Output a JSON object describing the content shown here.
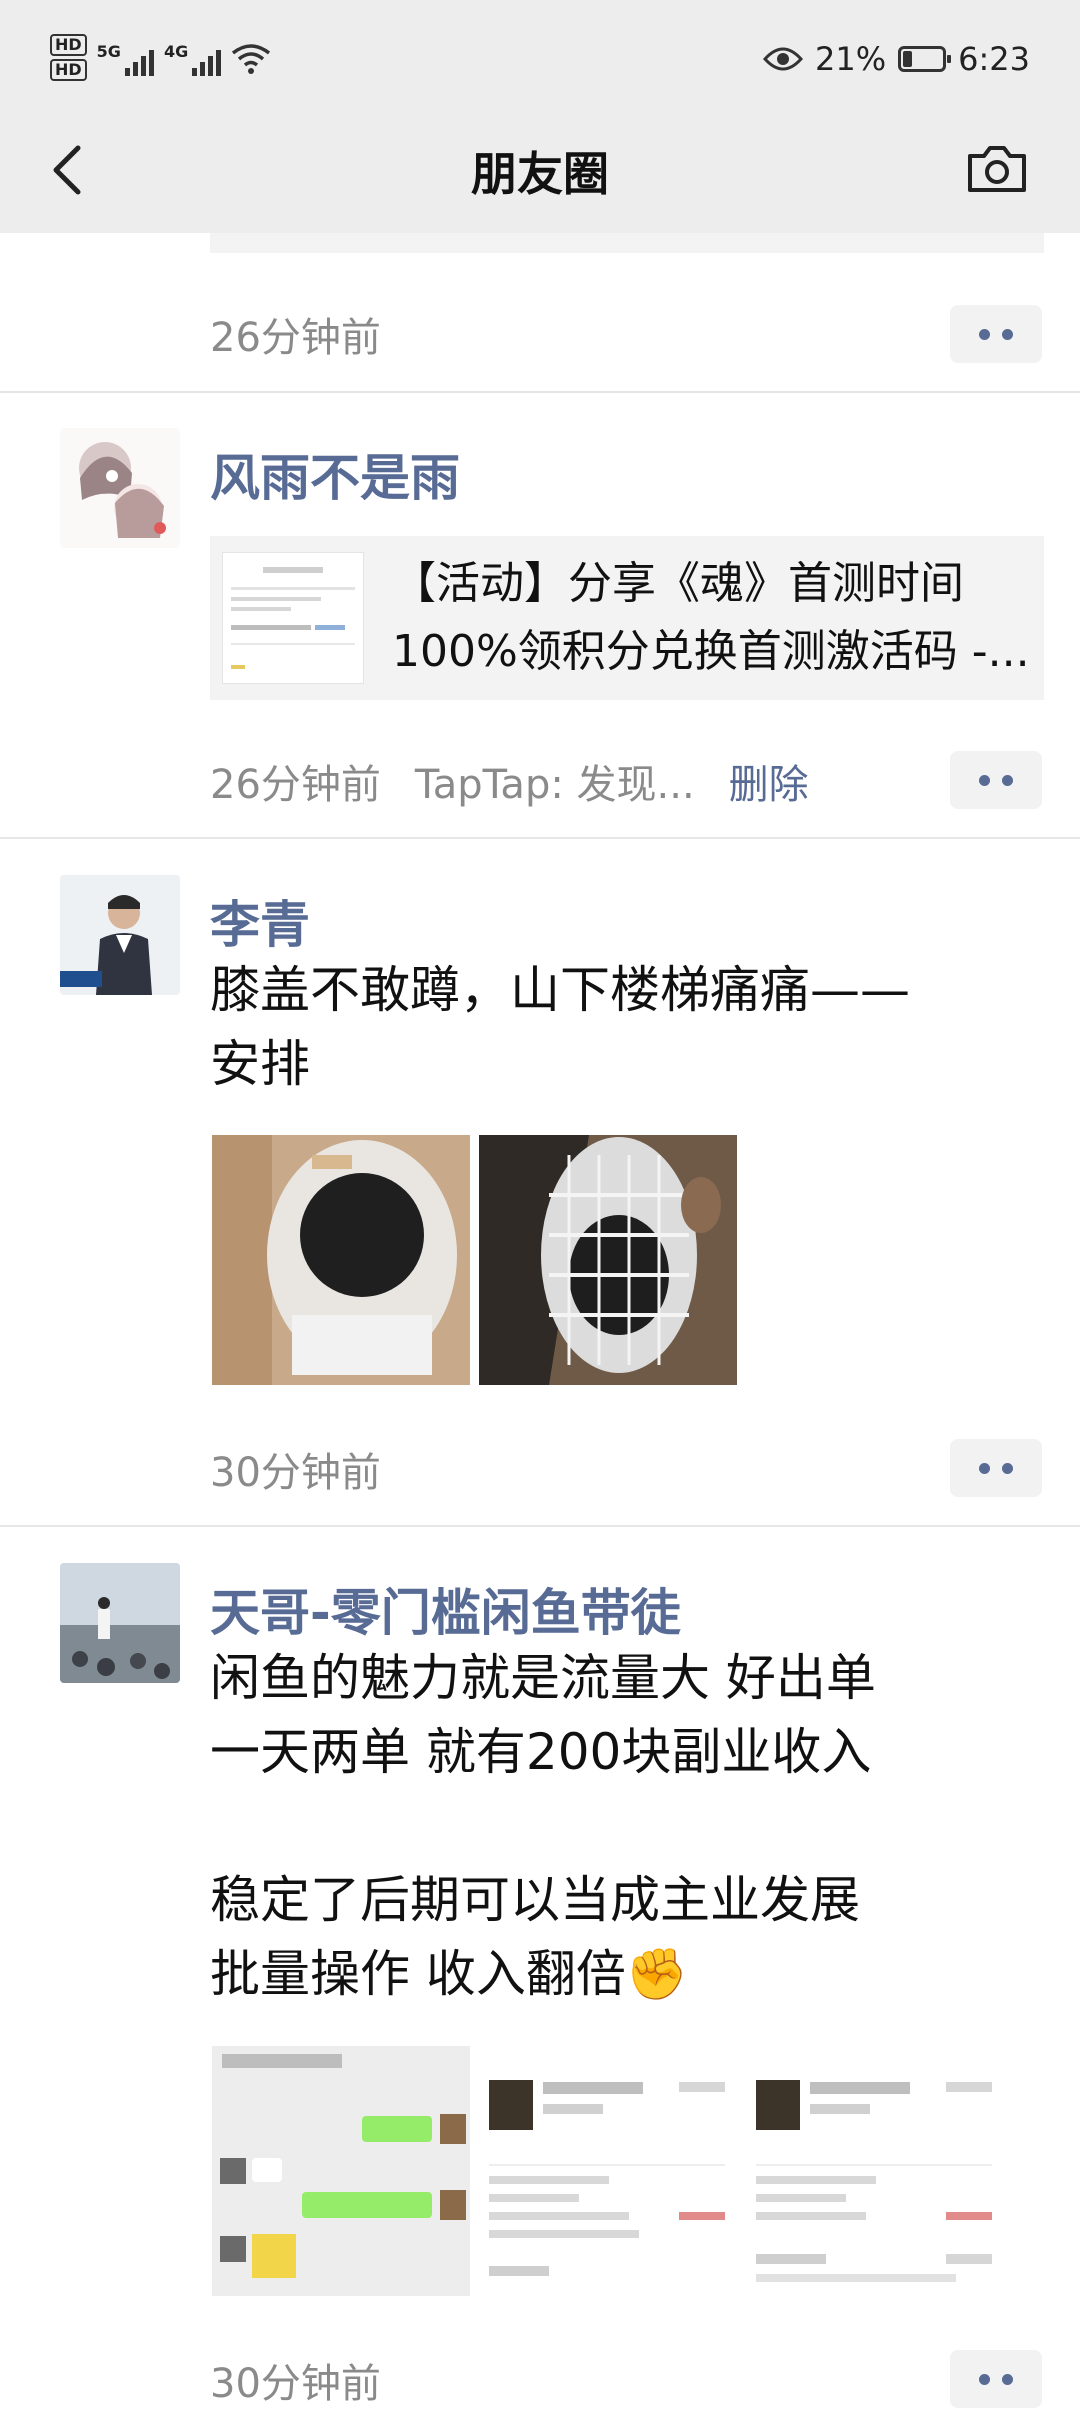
{
  "status_bar": {
    "hd1": "HD",
    "hd2": "HD",
    "net1": "5G",
    "net2": "4G",
    "battery_pct": "21%",
    "time": "6:23"
  },
  "header": {
    "title": "朋友圈"
  },
  "posts": [
    {
      "time": "26分钟前"
    },
    {
      "name": "风雨不是雨",
      "link_title_1": "【活动】分享《魂》首测时间",
      "link_title_2": "100%领积分兑换首测激活码 -...",
      "time": "26分钟前",
      "source": "TapTap: 发现...",
      "delete": "删除"
    },
    {
      "name": "李青",
      "text": "膝盖不敢蹲，山下楼梯痛痛——\n安排",
      "time": "30分钟前"
    },
    {
      "name": "天哥-零门槛闲鱼带徒",
      "text": "闲鱼的魅力就是流量大 好出单\n一天两单 就有200块副业收入\n\n稳定了后期可以当成主业发展\n批量操作 收入翻倍✊",
      "time": "30分钟前"
    }
  ]
}
